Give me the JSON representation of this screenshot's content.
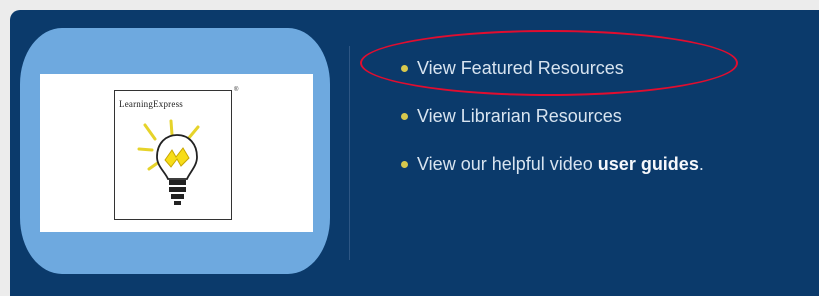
{
  "logo": {
    "brand": "LearningExpress",
    "registered_mark": "®",
    "icon": "lightbulb-icon"
  },
  "links": [
    {
      "text": "View Featured Resources"
    },
    {
      "text": "View Librarian Resources"
    },
    {
      "prefix": "View our helpful video ",
      "bold": "user guides",
      "suffix": "."
    }
  ],
  "colors": {
    "panel": "#0b3a6b",
    "logo_frame": "#6ea9df",
    "bullet": "#d7c84d",
    "link_text": "#d8e4f0",
    "highlight_ring": "#e10d2f"
  }
}
